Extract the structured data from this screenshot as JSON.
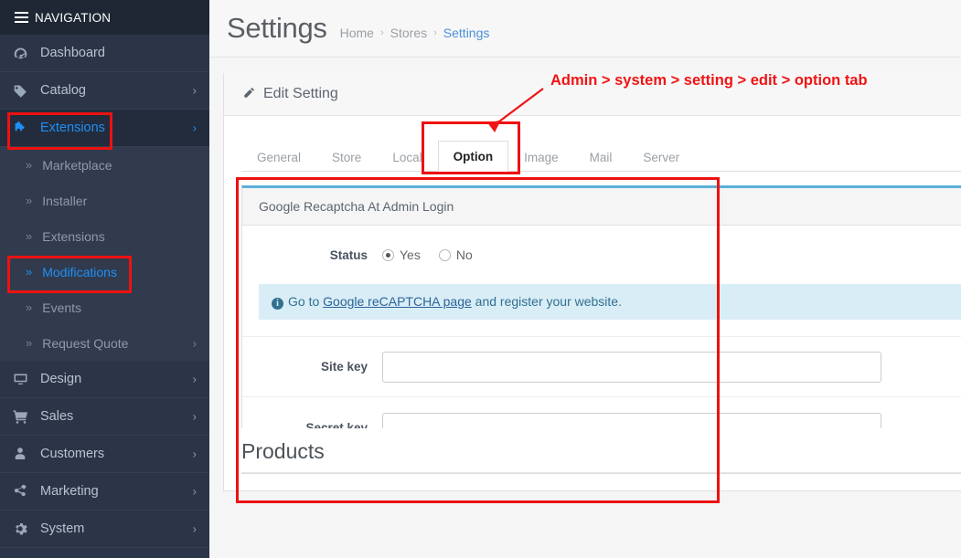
{
  "sidebar": {
    "header": "NAVIGATION",
    "items": [
      {
        "label": "Dashboard",
        "icon": "dashboard-icon",
        "caret": false,
        "active": false
      },
      {
        "label": "Catalog",
        "icon": "tag-icon",
        "caret": true,
        "active": false
      },
      {
        "label": "Extensions",
        "icon": "puzzle-icon",
        "caret": true,
        "active": true
      }
    ],
    "subitems": [
      {
        "label": "Marketplace",
        "caret": false,
        "active": false
      },
      {
        "label": "Installer",
        "caret": false,
        "active": false
      },
      {
        "label": "Extensions",
        "caret": false,
        "active": false
      },
      {
        "label": "Modifications",
        "caret": false,
        "active": true
      },
      {
        "label": "Events",
        "caret": false,
        "active": false
      },
      {
        "label": "Request Quote",
        "caret": true,
        "active": false
      }
    ],
    "items_after": [
      {
        "label": "Design",
        "icon": "monitor-icon",
        "caret": true,
        "active": false
      },
      {
        "label": "Sales",
        "icon": "cart-icon",
        "caret": true,
        "active": false
      },
      {
        "label": "Customers",
        "icon": "user-icon",
        "caret": true,
        "active": false
      },
      {
        "label": "Marketing",
        "icon": "share-icon",
        "caret": true,
        "active": false
      },
      {
        "label": "System",
        "icon": "gear-icon",
        "caret": true,
        "active": false
      }
    ]
  },
  "header": {
    "title": "Settings",
    "breadcrumbs": [
      {
        "label": "Home",
        "current": false
      },
      {
        "label": "Stores",
        "current": false
      },
      {
        "label": "Settings",
        "current": true
      }
    ],
    "separator": "›"
  },
  "panel": {
    "title": "Edit Setting",
    "icon": "pencil-icon"
  },
  "tabs": [
    {
      "label": "General",
      "active": false
    },
    {
      "label": "Store",
      "active": false
    },
    {
      "label": "Local",
      "active": false
    },
    {
      "label": "Option",
      "active": true
    },
    {
      "label": "Image",
      "active": false
    },
    {
      "label": "Mail",
      "active": false
    },
    {
      "label": "Server",
      "active": false
    }
  ],
  "form": {
    "section_title": "Google Recaptcha At Admin Login",
    "status": {
      "label": "Status",
      "options": [
        {
          "label": "Yes",
          "selected": true
        },
        {
          "label": "No",
          "selected": false
        }
      ]
    },
    "alert": {
      "icon": "info-icon",
      "prefix": "Go to ",
      "link": "Google reCAPTCHA page",
      "suffix": " and register your website."
    },
    "fields": [
      {
        "label": "Site key",
        "value": "",
        "placeholder": ""
      },
      {
        "label": "Secret key",
        "value": "",
        "placeholder": ""
      }
    ]
  },
  "products": {
    "title": "Products"
  },
  "annotation": {
    "text": "Admin > system > setting > edit > option tab",
    "color": "#f01414"
  },
  "colors": {
    "sidebar_bg": "#2b3547",
    "sidebar_header_bg": "#1f2735",
    "accent_blue": "#1e8ff5",
    "panel_top_border": "#5bafd8",
    "alert_bg": "#d9edf7",
    "annotation_red": "#ee1111"
  }
}
